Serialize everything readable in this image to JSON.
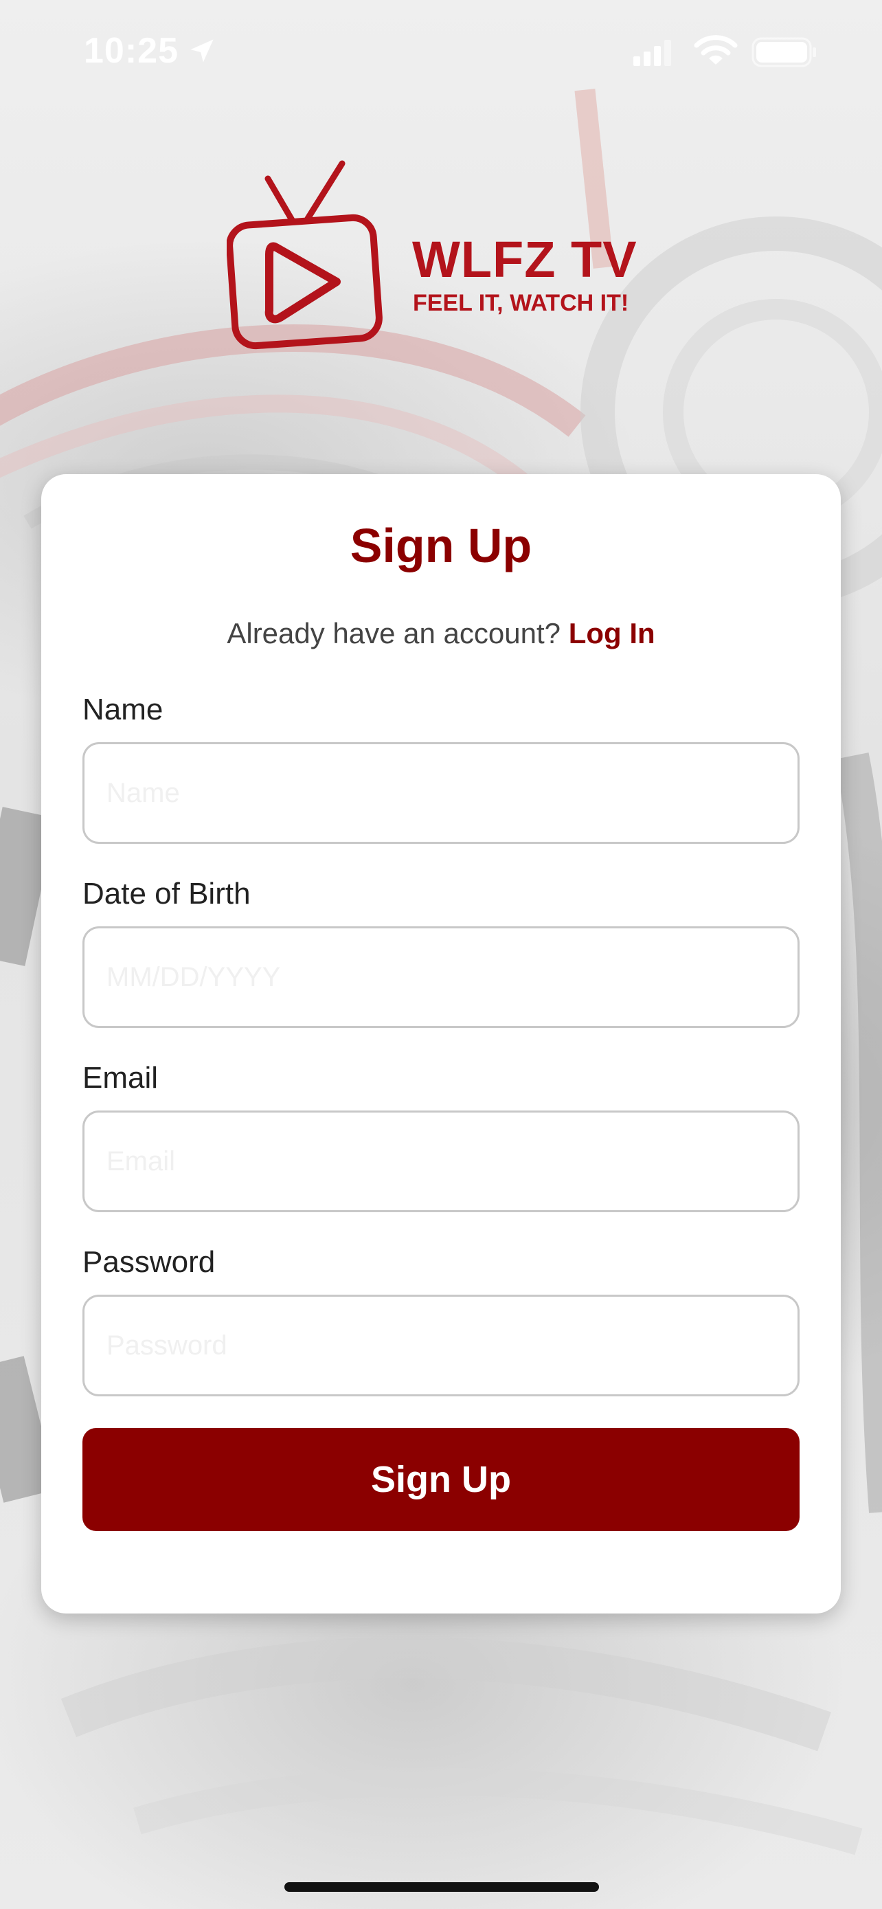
{
  "status_bar": {
    "time": "10:25",
    "location_icon": "location-arrow-icon",
    "signal_icon": "cellular-signal-icon",
    "wifi_icon": "wifi-icon",
    "battery_icon": "battery-icon"
  },
  "logo": {
    "icon": "tv-play-icon",
    "brand_name": "WLFZ TV",
    "tagline": "FEEL IT, WATCH IT!"
  },
  "form": {
    "title": "Sign Up",
    "login_prompt": "Already have an account?",
    "login_link": "Log In",
    "fields": [
      {
        "label": "Name",
        "placeholder": "Name",
        "value": ""
      },
      {
        "label": "Date of Birth",
        "placeholder": "MM/DD/YYYY",
        "value": ""
      },
      {
        "label": "Email",
        "placeholder": "Email",
        "value": ""
      },
      {
        "label": "Password",
        "placeholder": "Password",
        "value": ""
      }
    ],
    "submit_label": "Sign Up"
  },
  "colors": {
    "brand_red": "#b3131b",
    "accent_dark_red": "#8b0000",
    "card_background": "#ffffff"
  }
}
